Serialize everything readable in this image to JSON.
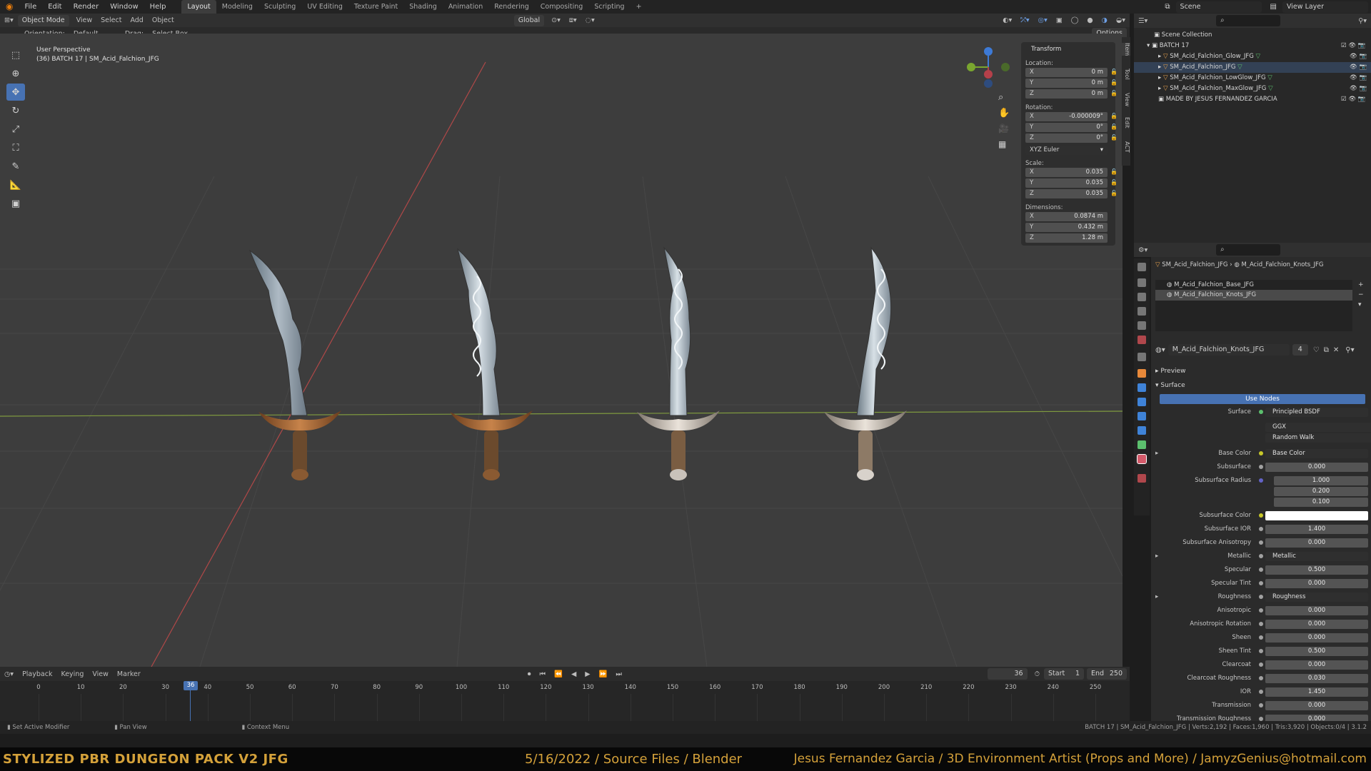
{
  "menu": {
    "items": [
      "File",
      "Edit",
      "Render",
      "Window",
      "Help"
    ]
  },
  "workspaces": {
    "tabs": [
      "Layout",
      "Modeling",
      "Sculpting",
      "UV Editing",
      "Texture Paint",
      "Shading",
      "Animation",
      "Rendering",
      "Compositing",
      "Scripting"
    ],
    "active": "Layout"
  },
  "topright": {
    "scene": "Scene",
    "view_layer": "View Layer"
  },
  "viewport_header": {
    "mode": "Object Mode",
    "menus": [
      "View",
      "Select",
      "Add",
      "Object"
    ],
    "orientation_global": "Global"
  },
  "tool_settings": {
    "orientation_label": "Orientation:",
    "orientation_value": "Default",
    "drag_label": "Drag:",
    "drag_value": "Select Box",
    "options": "Options"
  },
  "viewport": {
    "perspective": "User Perspective",
    "object_info": "(36) BATCH 17 | SM_Acid_Falchion_JFG"
  },
  "transform": {
    "title": "Transform",
    "location_label": "Location:",
    "location": [
      {
        "axis": "X",
        "value": "0 m"
      },
      {
        "axis": "Y",
        "value": "0 m"
      },
      {
        "axis": "Z",
        "value": "0 m"
      }
    ],
    "rotation_label": "Rotation:",
    "rotation": [
      {
        "axis": "X",
        "value": "-0.000009°"
      },
      {
        "axis": "Y",
        "value": "0°"
      },
      {
        "axis": "Z",
        "value": "0°"
      }
    ],
    "rotation_mode": "XYZ Euler",
    "scale_label": "Scale:",
    "scale": [
      {
        "axis": "X",
        "value": "0.035"
      },
      {
        "axis": "Y",
        "value": "0.035"
      },
      {
        "axis": "Z",
        "value": "0.035"
      }
    ],
    "dimensions_label": "Dimensions:",
    "dimensions": [
      {
        "axis": "X",
        "value": "0.0874 m"
      },
      {
        "axis": "Y",
        "value": "0.432 m"
      },
      {
        "axis": "Z",
        "value": "1.28 m"
      }
    ]
  },
  "n_tabs": [
    "Item",
    "Tool",
    "View",
    "Edit",
    "ACT"
  ],
  "outliner": {
    "root": "Scene Collection",
    "collection": "BATCH 17",
    "objects": [
      "SM_Acid_Falchion_Glow_JFG",
      "SM_Acid_Falchion_JFG",
      "SM_Acid_Falchion_LowGlow_JFG",
      "SM_Acid_Falchion_MaxGlow_JFG"
    ],
    "other": "MADE BY JESUS FERNANDEZ GARCIA"
  },
  "properties": {
    "breadcrumb": [
      "SM_Acid_Falchion_JFG",
      "M_Acid_Falchion_Knots_JFG"
    ],
    "slots": [
      "M_Acid_Falchion_Base_JFG",
      "M_Acid_Falchion_Knots_JFG"
    ],
    "material_name": "M_Acid_Falchion_Knots_JFG",
    "users": "4",
    "preview": "Preview",
    "surface_section": "Surface",
    "use_nodes": "Use Nodes",
    "surface_label": "Surface",
    "surface_value": "Principled BSDF",
    "distribution": "GGX",
    "subsurface_method": "Random Walk",
    "inputs": [
      {
        "label": "Base Color",
        "kind": "link",
        "value": "Base Color"
      },
      {
        "label": "Subsurface",
        "kind": "num",
        "value": "0.000",
        "fill": 0
      },
      {
        "label": "Subsurface Radius",
        "kind": "vec",
        "value": [
          "1.000",
          "0.200",
          "0.100"
        ]
      },
      {
        "label": "Subsurface Color",
        "kind": "color",
        "value": "#ffffff"
      },
      {
        "label": "Subsurface IOR",
        "kind": "num",
        "value": "1.400",
        "fill": 0.12
      },
      {
        "label": "Subsurface Anisotropy",
        "kind": "num",
        "value": "0.000",
        "fill": 0
      },
      {
        "label": "Metallic",
        "kind": "link",
        "value": "Metallic"
      },
      {
        "label": "Specular",
        "kind": "num",
        "value": "0.500",
        "fill": 0.5
      },
      {
        "label": "Specular Tint",
        "kind": "num",
        "value": "0.000",
        "fill": 0
      },
      {
        "label": "Roughness",
        "kind": "link",
        "value": "Roughness"
      },
      {
        "label": "Anisotropic",
        "kind": "num",
        "value": "0.000",
        "fill": 0
      },
      {
        "label": "Anisotropic Rotation",
        "kind": "num",
        "value": "0.000",
        "fill": 0
      },
      {
        "label": "Sheen",
        "kind": "num",
        "value": "0.000",
        "fill": 0
      },
      {
        "label": "Sheen Tint",
        "kind": "num",
        "value": "0.500",
        "fill": 0.5
      },
      {
        "label": "Clearcoat",
        "kind": "num",
        "value": "0.000",
        "fill": 0
      },
      {
        "label": "Clearcoat Roughness",
        "kind": "num",
        "value": "0.030",
        "fill": 0.03
      },
      {
        "label": "IOR",
        "kind": "num",
        "value": "1.450",
        "fill": 0
      },
      {
        "label": "Transmission",
        "kind": "num",
        "value": "0.000",
        "fill": 0
      },
      {
        "label": "Transmission Roughness",
        "kind": "num",
        "value": "0.000",
        "fill": 0
      }
    ]
  },
  "timeline": {
    "menus": [
      "Playback",
      "Keying",
      "View",
      "Marker"
    ],
    "current_frame": "36",
    "start_label": "Start",
    "start": "1",
    "end_label": "End",
    "end": "250",
    "ticks": [
      "0",
      "10",
      "20",
      "30",
      "40",
      "50",
      "60",
      "70",
      "80",
      "90",
      "100",
      "110",
      "120",
      "130",
      "140",
      "150",
      "160",
      "170",
      "180",
      "190",
      "200",
      "210",
      "220",
      "230",
      "240",
      "250"
    ]
  },
  "statusbar": {
    "left": [
      "Set Active Modifier",
      "Pan View",
      "Context Menu"
    ],
    "right": "BATCH 17 | SM_Acid_Falchion_JFG | Verts:2,192 | Faces:1,960 | Tris:3,920 | Objects:0/4 | 3.1.2"
  },
  "banner": {
    "title": "STYLIZED PBR DUNGEON PACK V2 JFG",
    "date": "5/16/2022 / Source Files / Blender",
    "author": "Jesus Fernandez Garcia / 3D Environment Artist (Props and More) / JamyzGenius@hotmail.com"
  },
  "colors": {
    "accent": "#4772b3",
    "banner_text": "#d4a13a",
    "axis_x": "#b5404a",
    "axis_y": "#7aa62f",
    "axis_z": "#3d7ad6"
  }
}
